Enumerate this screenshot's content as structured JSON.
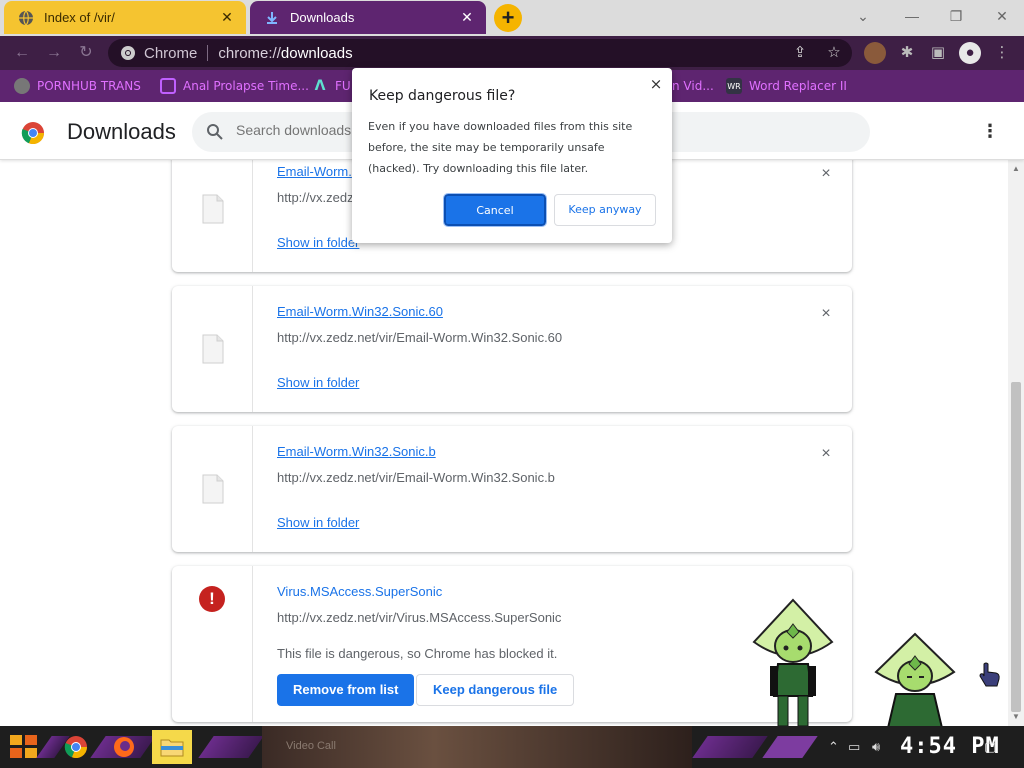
{
  "tabs": [
    {
      "title": "Index of /vir/",
      "icon": "globe-icon",
      "active": false,
      "accent": "#f5c430"
    },
    {
      "title": "Downloads",
      "icon": "download-icon",
      "active": true,
      "accent": "#5e2570"
    }
  ],
  "new_tab_label": "+",
  "omnibox": {
    "chip": "Chrome",
    "url_prefix": "chrome://",
    "url_path": "downloads"
  },
  "bookmarks": [
    {
      "label": "PORNHUB TRANS",
      "icon": "globe-icon"
    },
    {
      "label": "Anal Prolapse Time...",
      "icon": "bookmark-icon"
    },
    {
      "label": "FU",
      "icon": "bookmark-icon"
    },
    {
      "label": "n Vid...",
      "icon": "bookmark-icon"
    },
    {
      "label": "Word Replacer II",
      "icon": "extension-icon"
    }
  ],
  "header": {
    "title": "Downloads",
    "search_placeholder": "Search downloads",
    "more_label": "⋮"
  },
  "downloads": [
    {
      "name": "Email-Worm.",
      "url": "http://vx.zedz",
      "link": "Show in folder",
      "close": "×"
    },
    {
      "name": "Email-Worm.Win32.Sonic.60",
      "url": "http://vx.zedz.net/vir/Email-Worm.Win32.Sonic.60",
      "link": "Show in folder",
      "close": "×"
    },
    {
      "name": "Email-Worm.Win32.Sonic.b",
      "url": "http://vx.zedz.net/vir/Email-Worm.Win32.Sonic.b",
      "link": "Show in folder",
      "close": "×"
    },
    {
      "name": "Virus.MSAccess.SuperSonic",
      "url": "http://vx.zedz.net/vir/Virus.MSAccess.SuperSonic",
      "status": "This file is dangerous, so Chrome has blocked it.",
      "primary_button": "Remove from list",
      "secondary_button": "Keep dangerous file"
    }
  ],
  "dialog": {
    "title": "Keep dangerous file?",
    "body": "Even if you have downloaded files from this site before, the site may be temporarily unsafe (hacked). Try downloading this file later.",
    "cancel": "Cancel",
    "keep": "Keep anyway",
    "close": "×"
  },
  "taskbar": {
    "media_text": "Video Call",
    "clock": "4:54 PM"
  },
  "colors": {
    "brand_purple": "#5e2570",
    "accent_blue": "#1a73e8",
    "danger_red": "#c5221f"
  }
}
